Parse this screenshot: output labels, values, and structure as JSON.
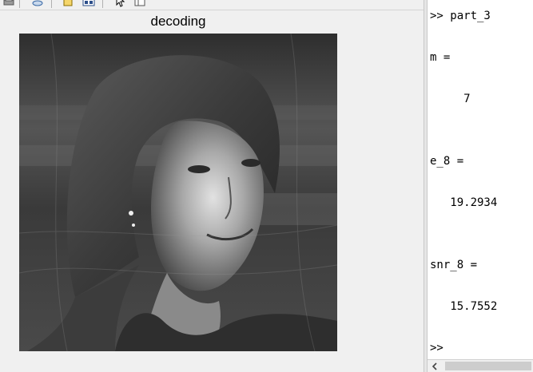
{
  "figure": {
    "toolbar": {
      "icons": [
        "print-icon",
        "link-icon",
        "insert-colorbar-icon",
        "insert-legend-icon",
        "select-arrow-icon",
        "property-inspector-icon"
      ]
    },
    "axes_title": "decoding",
    "image": {
      "description_icon": "grayscale-image",
      "colors": {
        "dark": "#2b2b2b",
        "mid": "#7a7a7a",
        "light": "#d8d8d8"
      }
    }
  },
  "command_window": {
    "lines": [
      {
        "type": "prompt",
        "text": ">> part_3"
      },
      {
        "type": "var",
        "text": "m ="
      },
      {
        "type": "value",
        "text": "     7"
      },
      {
        "type": "var",
        "text": "e_8 ="
      },
      {
        "type": "value",
        "text": "   19.2934"
      },
      {
        "type": "var",
        "text": "snr_8 ="
      },
      {
        "type": "value",
        "text": "   15.7552"
      },
      {
        "type": "prompt",
        "text": ">>"
      }
    ]
  },
  "scrollbar": {
    "left_arrow_icon": "scroll-left-icon"
  }
}
